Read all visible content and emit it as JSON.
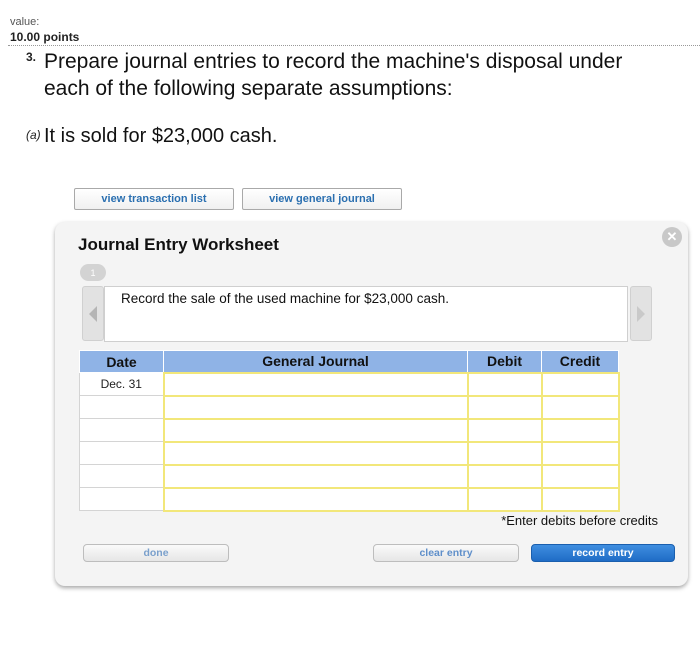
{
  "header": {
    "value_label": "value:",
    "points": "10.00 points"
  },
  "question": {
    "number": "3.",
    "text": "Prepare journal entries to record the machine's disposal under each of the following separate assumptions:",
    "part_letter": "(a)",
    "part_text": "It is sold for $23,000 cash."
  },
  "top_buttons": {
    "view_transactions": "view transaction list",
    "view_journal": "view general journal"
  },
  "worksheet": {
    "title": "Journal Entry Worksheet",
    "close_glyph": "✕",
    "step_indicator": "1",
    "instruction": "Record the sale of the used machine for $23,000 cash.",
    "columns": [
      "Date",
      "General Journal",
      "Debit",
      "Credit"
    ],
    "rows": [
      {
        "date": "Dec. 31",
        "account": "",
        "debit": "",
        "credit": ""
      },
      {
        "date": "",
        "account": "",
        "debit": "",
        "credit": ""
      },
      {
        "date": "",
        "account": "",
        "debit": "",
        "credit": ""
      },
      {
        "date": "",
        "account": "",
        "debit": "",
        "credit": ""
      },
      {
        "date": "",
        "account": "",
        "debit": "",
        "credit": ""
      },
      {
        "date": "",
        "account": "",
        "debit": "",
        "credit": ""
      }
    ],
    "note": "*Enter debits before credits",
    "buttons": {
      "done": "done",
      "clear": "clear entry",
      "record": "record entry"
    }
  },
  "colors": {
    "header_blue": "#8fb3e6",
    "input_border_yellow": "#f2e77a",
    "primary_button": "#1f6cc6"
  }
}
